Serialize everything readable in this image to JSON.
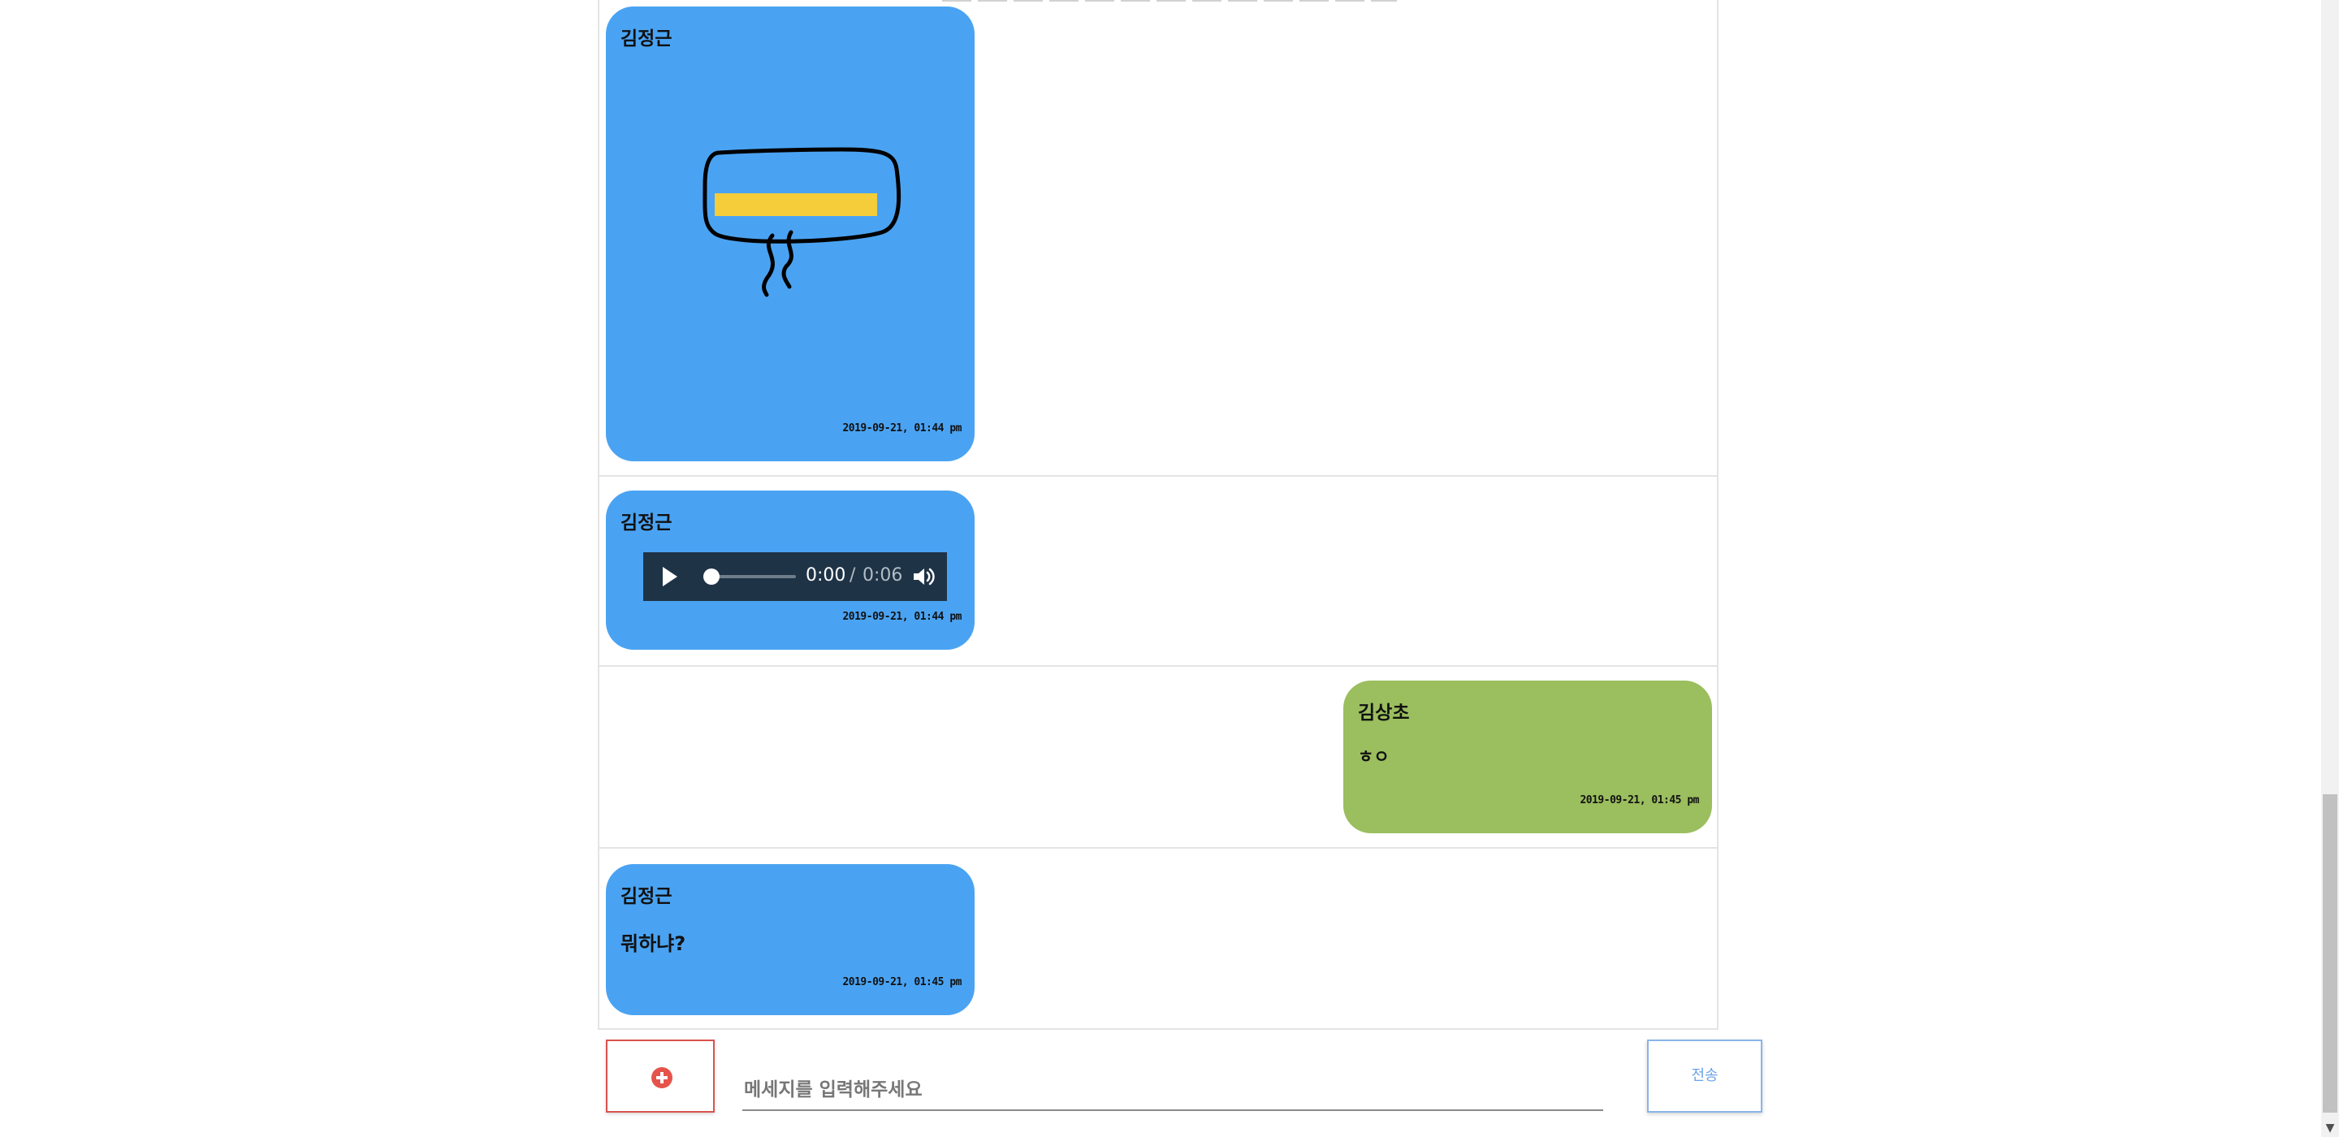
{
  "messages": [
    {
      "sender": "김정근",
      "type": "image",
      "image_icon": "drawing-image",
      "timestamp": "2019-09-21, 01:44 pm"
    },
    {
      "sender": "김정근",
      "type": "audio",
      "audio": {
        "current_time": "0:00",
        "separator": "/",
        "duration": "0:06"
      },
      "timestamp": "2019-09-21, 01:44 pm"
    },
    {
      "sender": "김상초",
      "type": "text",
      "text": "ㅎㅇ",
      "timestamp": "2019-09-21, 01:45 pm"
    },
    {
      "sender": "김정근",
      "type": "text",
      "text": "뭐하냐?",
      "timestamp": "2019-09-21, 01:45 pm"
    }
  ],
  "composer": {
    "attach_icon": "plus-circle-icon",
    "placeholder": "메세지를 입력해주세요",
    "send_label": "전송"
  },
  "colors": {
    "other_bubble": "#4aa3f2",
    "own_bubble": "#9bbe5e",
    "attach_border": "#d9534f",
    "send_border": "#8ab4e8"
  }
}
